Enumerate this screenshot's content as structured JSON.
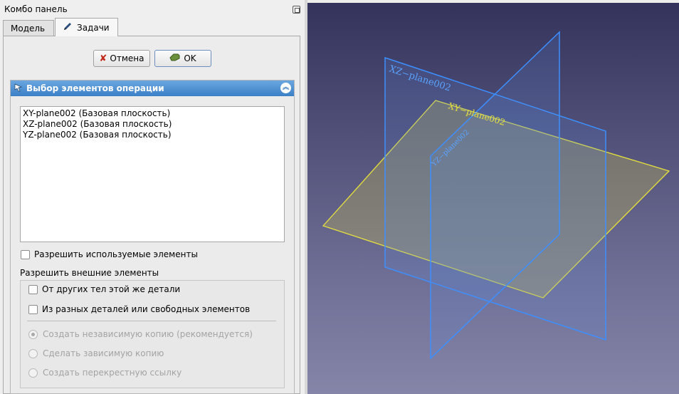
{
  "panel": {
    "title": "Комбо панель",
    "tabs": [
      {
        "label": "Модель"
      },
      {
        "label": "Задачи"
      }
    ]
  },
  "buttons": {
    "cancel": "Отмена",
    "ok": "OK"
  },
  "selection": {
    "title": "Выбор элементов операции",
    "items": [
      "XY-plane002 (Базовая плоскость)",
      "XZ-plane002 (Базовая плоскость)",
      "YZ-plane002 (Базовая плоскость)"
    ],
    "allow_used": {
      "label": "Разрешить используемые элементы",
      "checked": false
    },
    "external_label": "Разрешить внешние элементы",
    "same_body": {
      "label": "От других тел этой же детали",
      "checked": false
    },
    "different_parts": {
      "label": "Из разных деталей или свободных элементов",
      "checked": false
    },
    "radio_options": [
      {
        "label": "Создать независимую копию (рекомендуется)",
        "selected": true
      },
      {
        "label": "Сделать зависимую копию",
        "selected": false
      },
      {
        "label": "Создать перекрестную ссылку",
        "selected": false
      }
    ]
  },
  "viewport": {
    "planes": [
      {
        "label": "XZ−plane002",
        "color": "#3d8fff"
      },
      {
        "label": "XY−plane002",
        "color": "#e8e23c"
      },
      {
        "label": "YZ−plane002",
        "color": "#3d8fff"
      }
    ]
  }
}
